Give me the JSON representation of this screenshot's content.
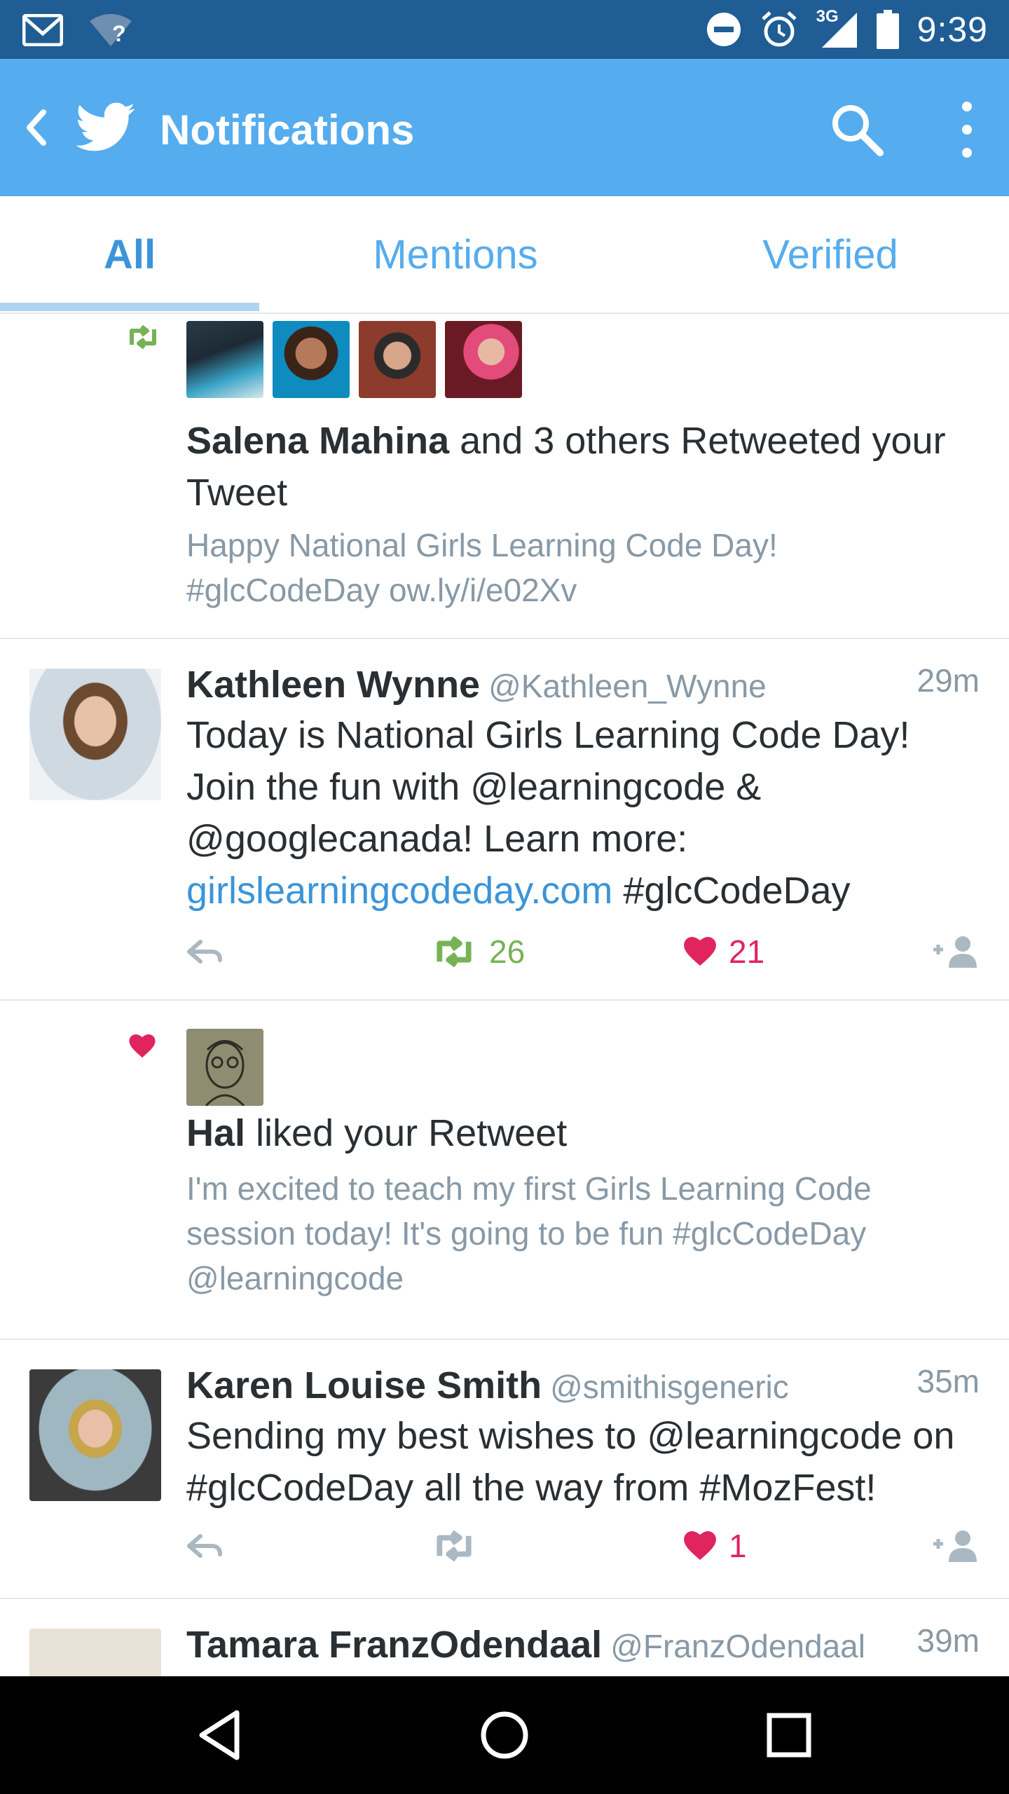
{
  "status_bar": {
    "time": "9:39",
    "network": "3G",
    "wifi_label": "?"
  },
  "app_bar": {
    "title": "Notifications"
  },
  "tabs": [
    {
      "label": "All",
      "selected": true
    },
    {
      "label": "Mentions",
      "selected": false
    },
    {
      "label": "Verified",
      "selected": false
    }
  ],
  "feed": {
    "retweet_notification": {
      "actor": "Salena Mahina",
      "text": " and 3 others Retweeted your Tweet",
      "snippet": "Happy National Girls Learning Code Day! #glcCodeDay ow.ly/i/e02Xv"
    },
    "tweet1": {
      "name": "Kathleen Wynne",
      "handle": "@Kathleen_Wynne",
      "time": "29m",
      "text_1": "Today is National Girls Learning Code Day! Join the fun with @learningcode & @googlecanada! Learn more: ",
      "link": "girlslearningcodeday.com",
      "text_2": " #glcCodeDay",
      "retweets": "26",
      "likes": "21"
    },
    "like_notification": {
      "actor": "Hal",
      "text": " liked your Retweet",
      "snippet": "I'm excited to teach my first Girls Learning Code session today! It's going to be fun #glcCodeDay @learningcode"
    },
    "tweet2": {
      "name": "Karen Louise Smith",
      "handle": "@smithisgeneric",
      "time": "35m",
      "text": "Sending my best wishes to @learningcode on #glcCodeDay all the way from #MozFest!",
      "retweets": "",
      "likes": "1"
    },
    "tweet3": {
      "name": "Tamara FranzOdendaal",
      "handle": "@FranzOdendaal",
      "time": "39m"
    }
  },
  "colors": {
    "status_bar": "#1f5d94",
    "app_bar": "#55acee",
    "link": "#3b94d9",
    "retweet": "#77b255",
    "like": "#e0245e",
    "muted": "#8899a6"
  },
  "icons": [
    "gmail-icon",
    "wifi-icon",
    "dnd-icon",
    "alarm-icon",
    "signal-icon",
    "battery-icon",
    "back-arrow-icon",
    "twitter-bird-icon",
    "search-icon",
    "more-vert-icon",
    "retweet-icon",
    "heart-icon",
    "reply-icon",
    "follow-icon",
    "nav-back-icon",
    "nav-home-icon",
    "nav-recents-icon"
  ]
}
